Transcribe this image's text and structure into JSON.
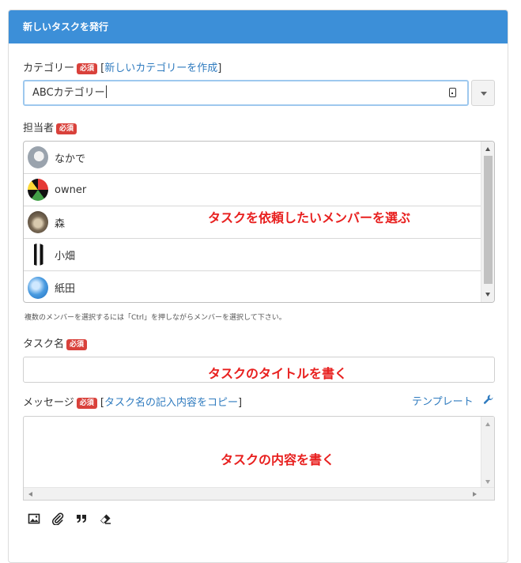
{
  "header": {
    "title": "新しいタスクを発行"
  },
  "required_badge": "必須",
  "category": {
    "label": "カテゴリー",
    "bracket_open": "[",
    "bracket_close": "]",
    "new_link": "新しいカテゴリーを作成",
    "value": "ABCカテゴリー"
  },
  "assignee": {
    "label": "担当者",
    "members": [
      {
        "name": "なかで",
        "avatar_color": "#9aa3ad"
      },
      {
        "name": "owner",
        "avatar_color": "#1a1a1a"
      },
      {
        "name": "森",
        "avatar_color": "#7a6a55"
      },
      {
        "name": "小畑",
        "avatar_color": "#e6e6e6"
      },
      {
        "name": "紙田",
        "avatar_color": "#4a9be0"
      }
    ],
    "annotation": "タスクを依頼したいメンバーを選ぶ",
    "hint": "複数のメンバーを選択するには「Ctrl」を押しながらメンバーを選択して下さい。"
  },
  "task_name": {
    "label": "タスク名",
    "annotation": "タスクのタイトルを書く"
  },
  "message": {
    "label": "メッセージ",
    "bracket_open": "[",
    "bracket_close": "]",
    "copy_link": "タスク名の記入内容をコピー",
    "template_link": "テンプレート",
    "annotation": "タスクの内容を書く"
  },
  "toolbar": {
    "icons": [
      "image-icon",
      "paperclip-icon",
      "quote-icon",
      "eraser-icon"
    ]
  },
  "colors": {
    "header_bg": "#3c8fd8",
    "required_badge": "#d9413b",
    "link": "#2f7bbf",
    "annotation": "#e8201f"
  }
}
